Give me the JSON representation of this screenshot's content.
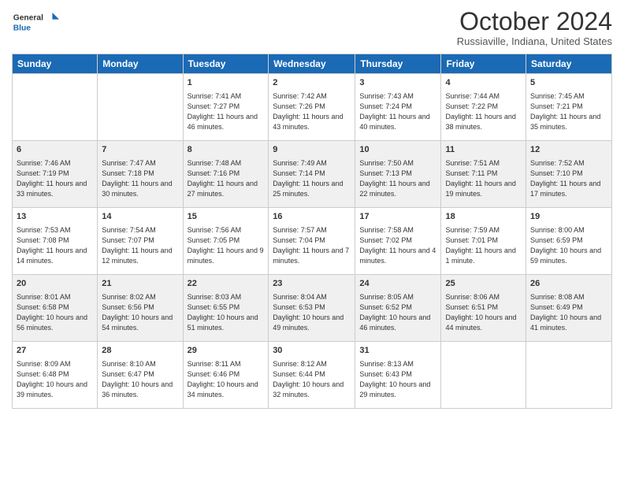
{
  "logo": {
    "line1": "General",
    "line2": "Blue"
  },
  "title": "October 2024",
  "subtitle": "Russiaville, Indiana, United States",
  "days_of_week": [
    "Sunday",
    "Monday",
    "Tuesday",
    "Wednesday",
    "Thursday",
    "Friday",
    "Saturday"
  ],
  "weeks": [
    [
      {
        "day": "",
        "info": ""
      },
      {
        "day": "",
        "info": ""
      },
      {
        "day": "1",
        "info": "Sunrise: 7:41 AM\nSunset: 7:27 PM\nDaylight: 11 hours and 46 minutes."
      },
      {
        "day": "2",
        "info": "Sunrise: 7:42 AM\nSunset: 7:26 PM\nDaylight: 11 hours and 43 minutes."
      },
      {
        "day": "3",
        "info": "Sunrise: 7:43 AM\nSunset: 7:24 PM\nDaylight: 11 hours and 40 minutes."
      },
      {
        "day": "4",
        "info": "Sunrise: 7:44 AM\nSunset: 7:22 PM\nDaylight: 11 hours and 38 minutes."
      },
      {
        "day": "5",
        "info": "Sunrise: 7:45 AM\nSunset: 7:21 PM\nDaylight: 11 hours and 35 minutes."
      }
    ],
    [
      {
        "day": "6",
        "info": "Sunrise: 7:46 AM\nSunset: 7:19 PM\nDaylight: 11 hours and 33 minutes."
      },
      {
        "day": "7",
        "info": "Sunrise: 7:47 AM\nSunset: 7:18 PM\nDaylight: 11 hours and 30 minutes."
      },
      {
        "day": "8",
        "info": "Sunrise: 7:48 AM\nSunset: 7:16 PM\nDaylight: 11 hours and 27 minutes."
      },
      {
        "day": "9",
        "info": "Sunrise: 7:49 AM\nSunset: 7:14 PM\nDaylight: 11 hours and 25 minutes."
      },
      {
        "day": "10",
        "info": "Sunrise: 7:50 AM\nSunset: 7:13 PM\nDaylight: 11 hours and 22 minutes."
      },
      {
        "day": "11",
        "info": "Sunrise: 7:51 AM\nSunset: 7:11 PM\nDaylight: 11 hours and 19 minutes."
      },
      {
        "day": "12",
        "info": "Sunrise: 7:52 AM\nSunset: 7:10 PM\nDaylight: 11 hours and 17 minutes."
      }
    ],
    [
      {
        "day": "13",
        "info": "Sunrise: 7:53 AM\nSunset: 7:08 PM\nDaylight: 11 hours and 14 minutes."
      },
      {
        "day": "14",
        "info": "Sunrise: 7:54 AM\nSunset: 7:07 PM\nDaylight: 11 hours and 12 minutes."
      },
      {
        "day": "15",
        "info": "Sunrise: 7:56 AM\nSunset: 7:05 PM\nDaylight: 11 hours and 9 minutes."
      },
      {
        "day": "16",
        "info": "Sunrise: 7:57 AM\nSunset: 7:04 PM\nDaylight: 11 hours and 7 minutes."
      },
      {
        "day": "17",
        "info": "Sunrise: 7:58 AM\nSunset: 7:02 PM\nDaylight: 11 hours and 4 minutes."
      },
      {
        "day": "18",
        "info": "Sunrise: 7:59 AM\nSunset: 7:01 PM\nDaylight: 11 hours and 1 minute."
      },
      {
        "day": "19",
        "info": "Sunrise: 8:00 AM\nSunset: 6:59 PM\nDaylight: 10 hours and 59 minutes."
      }
    ],
    [
      {
        "day": "20",
        "info": "Sunrise: 8:01 AM\nSunset: 6:58 PM\nDaylight: 10 hours and 56 minutes."
      },
      {
        "day": "21",
        "info": "Sunrise: 8:02 AM\nSunset: 6:56 PM\nDaylight: 10 hours and 54 minutes."
      },
      {
        "day": "22",
        "info": "Sunrise: 8:03 AM\nSunset: 6:55 PM\nDaylight: 10 hours and 51 minutes."
      },
      {
        "day": "23",
        "info": "Sunrise: 8:04 AM\nSunset: 6:53 PM\nDaylight: 10 hours and 49 minutes."
      },
      {
        "day": "24",
        "info": "Sunrise: 8:05 AM\nSunset: 6:52 PM\nDaylight: 10 hours and 46 minutes."
      },
      {
        "day": "25",
        "info": "Sunrise: 8:06 AM\nSunset: 6:51 PM\nDaylight: 10 hours and 44 minutes."
      },
      {
        "day": "26",
        "info": "Sunrise: 8:08 AM\nSunset: 6:49 PM\nDaylight: 10 hours and 41 minutes."
      }
    ],
    [
      {
        "day": "27",
        "info": "Sunrise: 8:09 AM\nSunset: 6:48 PM\nDaylight: 10 hours and 39 minutes."
      },
      {
        "day": "28",
        "info": "Sunrise: 8:10 AM\nSunset: 6:47 PM\nDaylight: 10 hours and 36 minutes."
      },
      {
        "day": "29",
        "info": "Sunrise: 8:11 AM\nSunset: 6:46 PM\nDaylight: 10 hours and 34 minutes."
      },
      {
        "day": "30",
        "info": "Sunrise: 8:12 AM\nSunset: 6:44 PM\nDaylight: 10 hours and 32 minutes."
      },
      {
        "day": "31",
        "info": "Sunrise: 8:13 AM\nSunset: 6:43 PM\nDaylight: 10 hours and 29 minutes."
      },
      {
        "day": "",
        "info": ""
      },
      {
        "day": "",
        "info": ""
      }
    ]
  ]
}
